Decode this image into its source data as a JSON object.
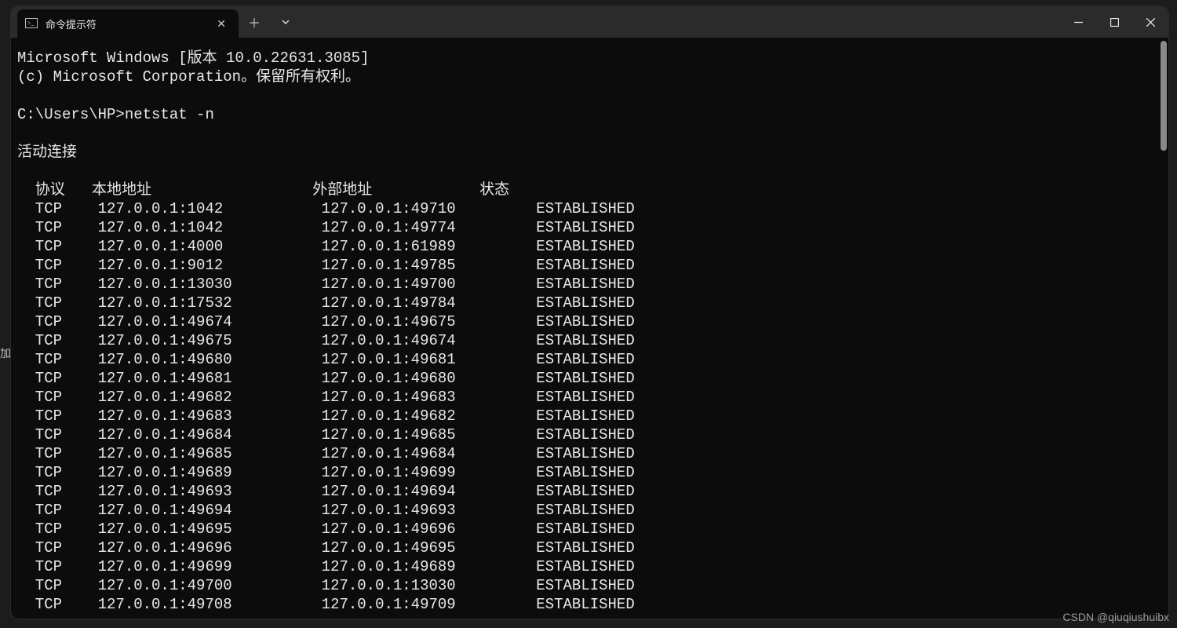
{
  "edge_hint": "加",
  "tab": {
    "title": "命令提示符"
  },
  "banner": {
    "line1": "Microsoft Windows [版本 10.0.22631.3085]",
    "line2": "(c) Microsoft Corporation。保留所有权利。"
  },
  "prompt": {
    "path": "C:\\Users\\HP>",
    "command": "netstat -n"
  },
  "section_title": "活动连接",
  "headers": {
    "proto": "协议",
    "local": "本地地址",
    "foreign": "外部地址",
    "state": "状态"
  },
  "rows": [
    {
      "proto": "TCP",
      "local": "127.0.0.1:1042",
      "foreign": "127.0.0.1:49710",
      "state": "ESTABLISHED"
    },
    {
      "proto": "TCP",
      "local": "127.0.0.1:1042",
      "foreign": "127.0.0.1:49774",
      "state": "ESTABLISHED"
    },
    {
      "proto": "TCP",
      "local": "127.0.0.1:4000",
      "foreign": "127.0.0.1:61989",
      "state": "ESTABLISHED"
    },
    {
      "proto": "TCP",
      "local": "127.0.0.1:9012",
      "foreign": "127.0.0.1:49785",
      "state": "ESTABLISHED"
    },
    {
      "proto": "TCP",
      "local": "127.0.0.1:13030",
      "foreign": "127.0.0.1:49700",
      "state": "ESTABLISHED"
    },
    {
      "proto": "TCP",
      "local": "127.0.0.1:17532",
      "foreign": "127.0.0.1:49784",
      "state": "ESTABLISHED"
    },
    {
      "proto": "TCP",
      "local": "127.0.0.1:49674",
      "foreign": "127.0.0.1:49675",
      "state": "ESTABLISHED"
    },
    {
      "proto": "TCP",
      "local": "127.0.0.1:49675",
      "foreign": "127.0.0.1:49674",
      "state": "ESTABLISHED"
    },
    {
      "proto": "TCP",
      "local": "127.0.0.1:49680",
      "foreign": "127.0.0.1:49681",
      "state": "ESTABLISHED"
    },
    {
      "proto": "TCP",
      "local": "127.0.0.1:49681",
      "foreign": "127.0.0.1:49680",
      "state": "ESTABLISHED"
    },
    {
      "proto": "TCP",
      "local": "127.0.0.1:49682",
      "foreign": "127.0.0.1:49683",
      "state": "ESTABLISHED"
    },
    {
      "proto": "TCP",
      "local": "127.0.0.1:49683",
      "foreign": "127.0.0.1:49682",
      "state": "ESTABLISHED"
    },
    {
      "proto": "TCP",
      "local": "127.0.0.1:49684",
      "foreign": "127.0.0.1:49685",
      "state": "ESTABLISHED"
    },
    {
      "proto": "TCP",
      "local": "127.0.0.1:49685",
      "foreign": "127.0.0.1:49684",
      "state": "ESTABLISHED"
    },
    {
      "proto": "TCP",
      "local": "127.0.0.1:49689",
      "foreign": "127.0.0.1:49699",
      "state": "ESTABLISHED"
    },
    {
      "proto": "TCP",
      "local": "127.0.0.1:49693",
      "foreign": "127.0.0.1:49694",
      "state": "ESTABLISHED"
    },
    {
      "proto": "TCP",
      "local": "127.0.0.1:49694",
      "foreign": "127.0.0.1:49693",
      "state": "ESTABLISHED"
    },
    {
      "proto": "TCP",
      "local": "127.0.0.1:49695",
      "foreign": "127.0.0.1:49696",
      "state": "ESTABLISHED"
    },
    {
      "proto": "TCP",
      "local": "127.0.0.1:49696",
      "foreign": "127.0.0.1:49695",
      "state": "ESTABLISHED"
    },
    {
      "proto": "TCP",
      "local": "127.0.0.1:49699",
      "foreign": "127.0.0.1:49689",
      "state": "ESTABLISHED"
    },
    {
      "proto": "TCP",
      "local": "127.0.0.1:49700",
      "foreign": "127.0.0.1:13030",
      "state": "ESTABLISHED"
    },
    {
      "proto": "TCP",
      "local": "127.0.0.1:49708",
      "foreign": "127.0.0.1:49709",
      "state": "ESTABLISHED"
    }
  ],
  "watermark": "CSDN @qiuqiushuibx"
}
